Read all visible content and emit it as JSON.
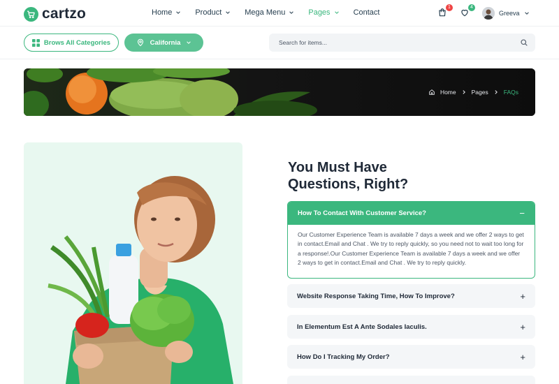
{
  "brand": {
    "name": "cartzo",
    "color": "#3bb77e"
  },
  "nav": {
    "items": [
      {
        "label": "Home",
        "dropdown": true,
        "active": false
      },
      {
        "label": "Product",
        "dropdown": true,
        "active": false
      },
      {
        "label": "Mega Menu",
        "dropdown": true,
        "active": false
      },
      {
        "label": "Pages",
        "dropdown": true,
        "active": true
      },
      {
        "label": "Contact",
        "dropdown": false,
        "active": false
      }
    ]
  },
  "header": {
    "cart_badge": "1",
    "wishlist_badge": "4",
    "user_name": "Greeva"
  },
  "subbar": {
    "categories_label": "Brows All Categories",
    "location_label": "California",
    "search_placeholder": "Search for items..."
  },
  "breadcrumb": {
    "home": "Home",
    "pages": "Pages",
    "current": "FAQs"
  },
  "faq": {
    "title_line1": "You Must Have",
    "title_line2": "Questions, Right?",
    "open_item": {
      "question": "How To Contact With Customer Service?",
      "answer": "Our Customer Experience Team is available 7 days a week and we offer 2 ways to get in contact.Email and Chat . We try to reply quickly, so you need not to wait too long for a response!.Our Customer Experience Team is available 7 days a week and we offer 2 ways to get in contact.Email and Chat . We try to reply quickly."
    },
    "items": [
      {
        "question": "Website Response Taking Time, How To Improve?"
      },
      {
        "question": "In Elementum Est A Ante Sodales Iaculis."
      },
      {
        "question": "How Do I Tracking My Order?"
      }
    ]
  }
}
